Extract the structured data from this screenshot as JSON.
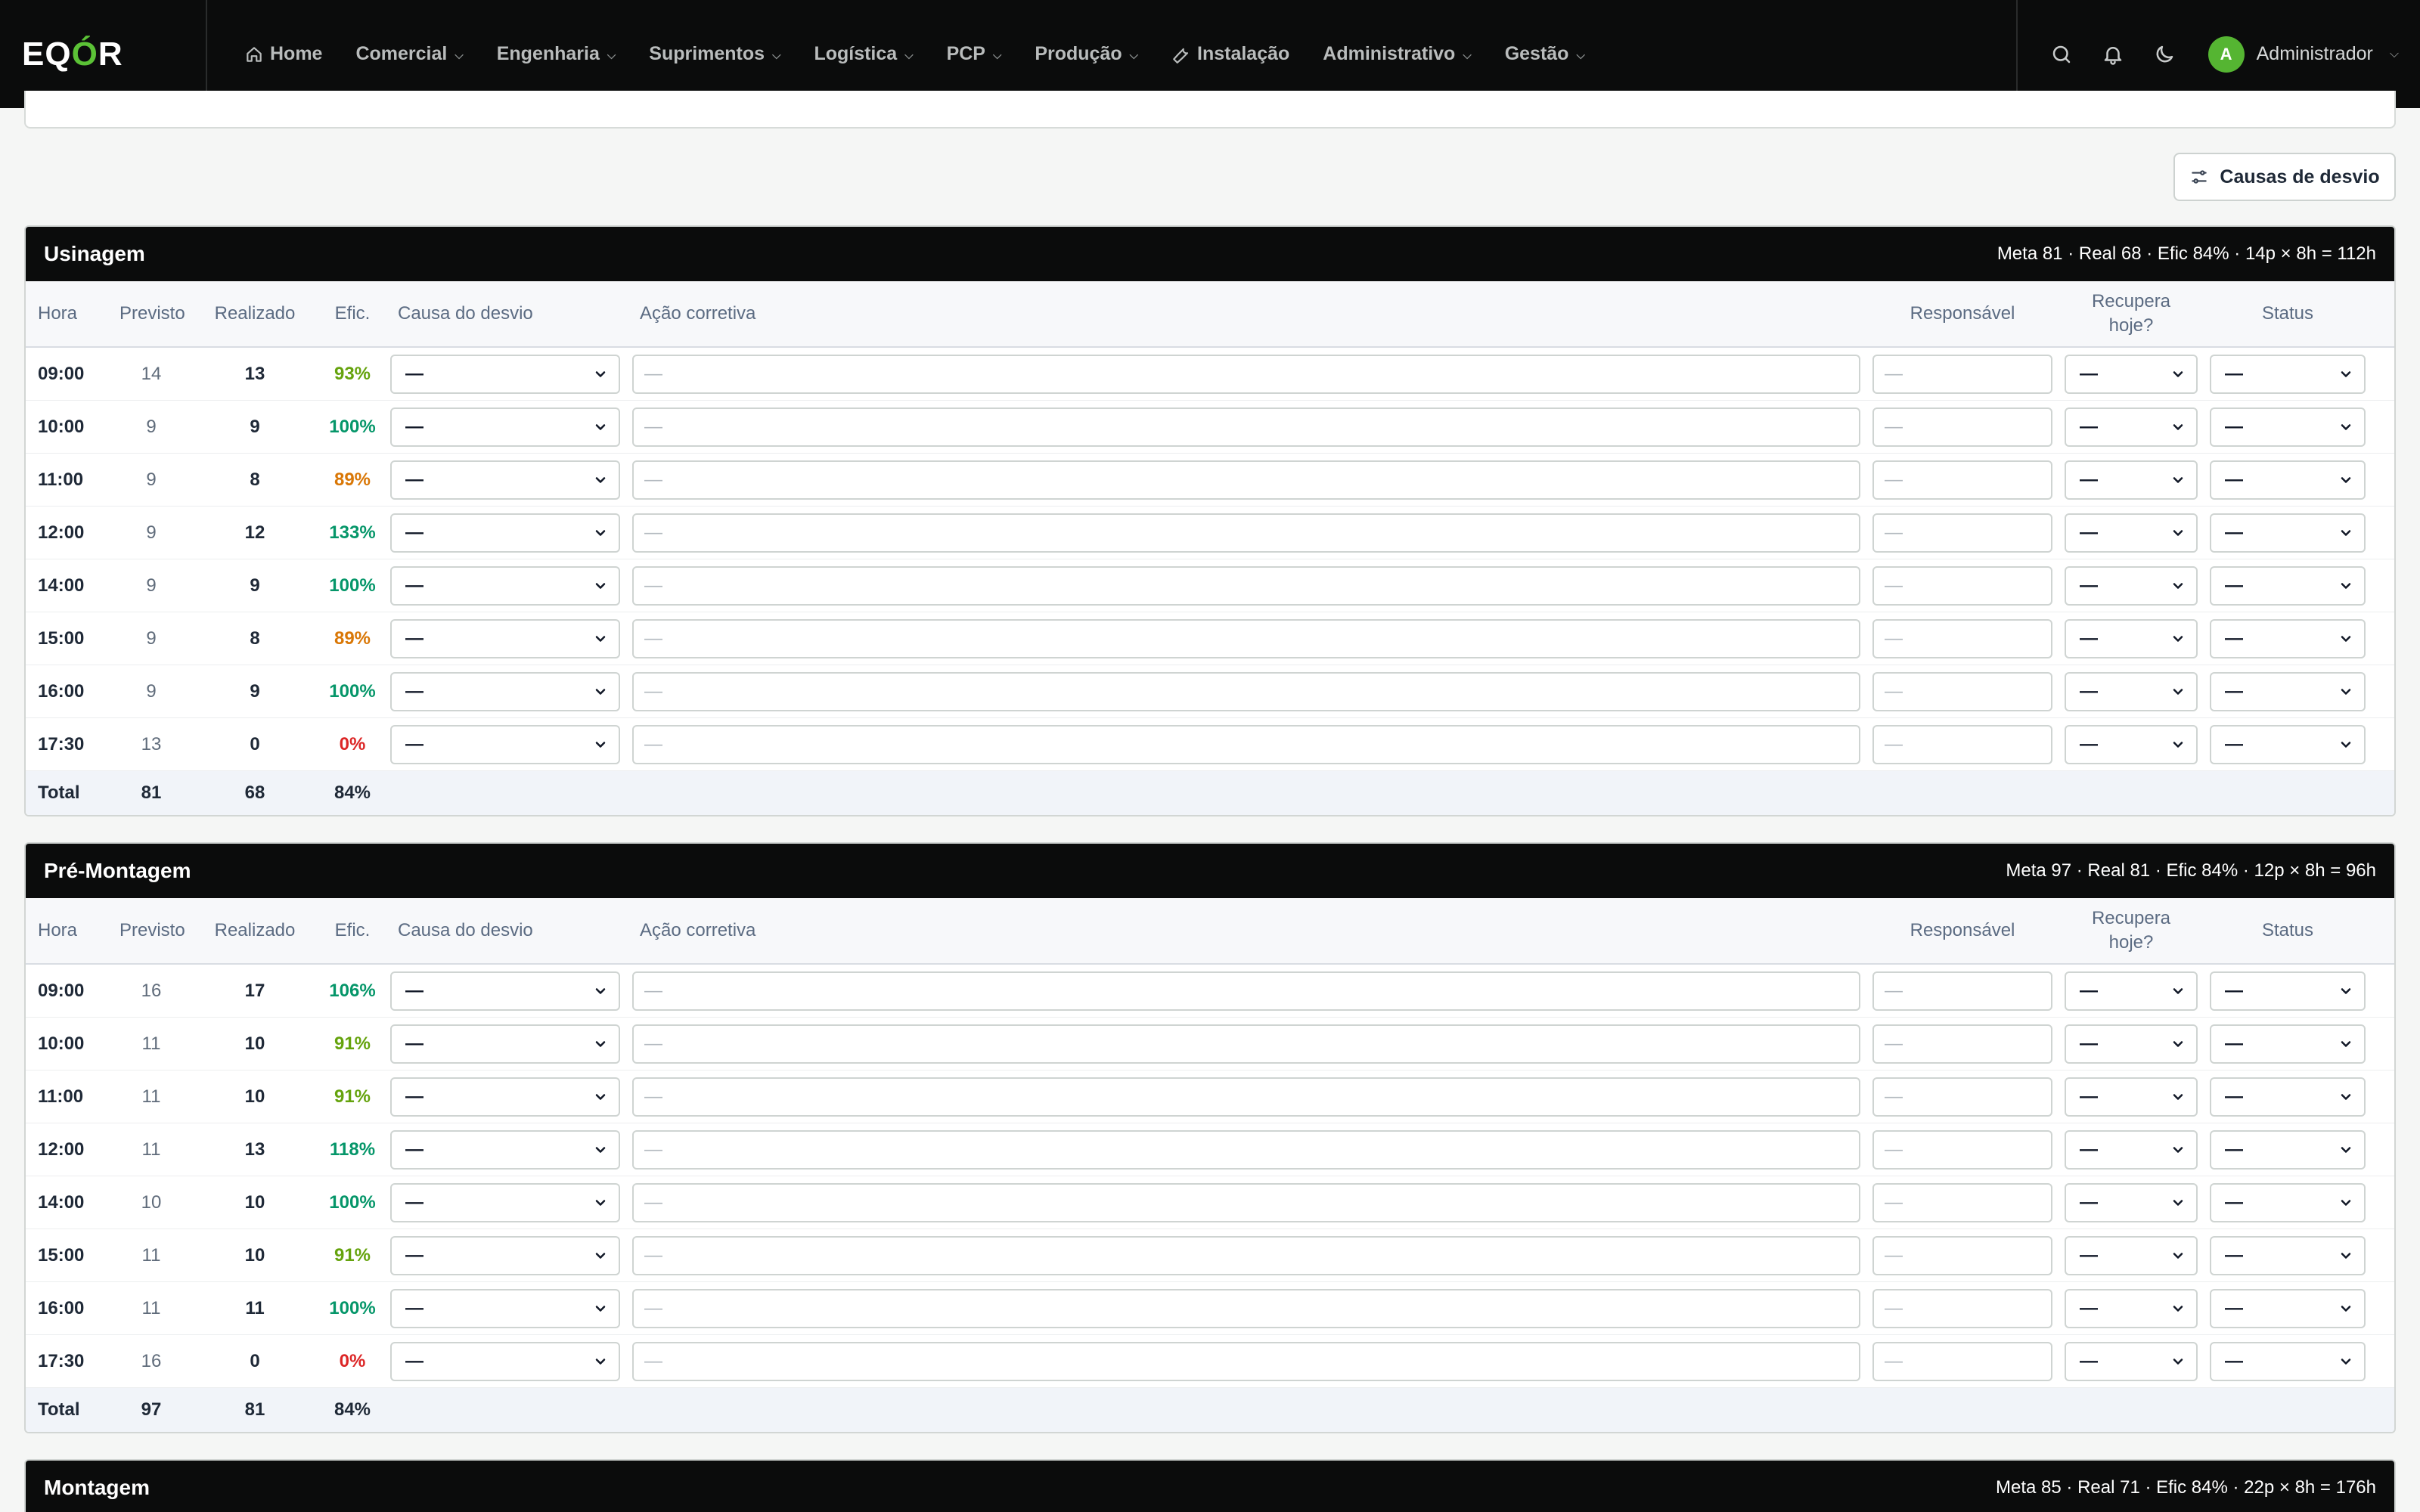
{
  "brand": {
    "prefix": "EQ",
    "o": "Ó",
    "suffix": "R"
  },
  "nav": [
    {
      "label": "Home",
      "icon": "home-icon",
      "dropdown": false
    },
    {
      "label": "Comercial",
      "dropdown": true
    },
    {
      "label": "Engenharia",
      "dropdown": true
    },
    {
      "label": "Suprimentos",
      "dropdown": true
    },
    {
      "label": "Logística",
      "dropdown": true
    },
    {
      "label": "PCP",
      "dropdown": true
    },
    {
      "label": "Produção",
      "dropdown": true
    },
    {
      "label": "Instalação",
      "icon": "wrench-icon",
      "dropdown": false
    },
    {
      "label": "Administrativo",
      "dropdown": true
    },
    {
      "label": "Gestão",
      "dropdown": true
    }
  ],
  "user": {
    "initial": "A",
    "name": "Administrador"
  },
  "causas_button": "Causas de desvio",
  "columns": {
    "hora": "Hora",
    "previsto": "Previsto",
    "realizado": "Realizado",
    "efic": "Efic.",
    "causa": "Causa do desvio",
    "acao": "Ação corretiva",
    "responsavel": "Responsável",
    "recupera": "Recupera hoje?",
    "status": "Status"
  },
  "placeholder": "—",
  "select_value": "—",
  "total_label": "Total",
  "sections": [
    {
      "title": "Usinagem",
      "summary": "Meta 81 · Real 68 · Efic 84% · 14p × 8h = 112h",
      "rows": [
        {
          "hora": "09:00",
          "previsto": "14",
          "realizado": "13",
          "efic": "93%",
          "tone": "lime"
        },
        {
          "hora": "10:00",
          "previsto": "9",
          "realizado": "9",
          "efic": "100%",
          "tone": "teal"
        },
        {
          "hora": "11:00",
          "previsto": "9",
          "realizado": "8",
          "efic": "89%",
          "tone": "orange"
        },
        {
          "hora": "12:00",
          "previsto": "9",
          "realizado": "12",
          "efic": "133%",
          "tone": "teal"
        },
        {
          "hora": "14:00",
          "previsto": "9",
          "realizado": "9",
          "efic": "100%",
          "tone": "teal"
        },
        {
          "hora": "15:00",
          "previsto": "9",
          "realizado": "8",
          "efic": "89%",
          "tone": "orange"
        },
        {
          "hora": "16:00",
          "previsto": "9",
          "realizado": "9",
          "efic": "100%",
          "tone": "teal"
        },
        {
          "hora": "17:30",
          "previsto": "13",
          "realizado": "0",
          "efic": "0%",
          "tone": "red"
        }
      ],
      "total": {
        "previsto": "81",
        "realizado": "68",
        "efic": "84%",
        "tone": "orange"
      }
    },
    {
      "title": "Pré-Montagem",
      "summary": "Meta 97 · Real 81 · Efic 84% · 12p × 8h = 96h",
      "rows": [
        {
          "hora": "09:00",
          "previsto": "16",
          "realizado": "17",
          "efic": "106%",
          "tone": "teal"
        },
        {
          "hora": "10:00",
          "previsto": "11",
          "realizado": "10",
          "efic": "91%",
          "tone": "lime"
        },
        {
          "hora": "11:00",
          "previsto": "11",
          "realizado": "10",
          "efic": "91%",
          "tone": "lime"
        },
        {
          "hora": "12:00",
          "previsto": "11",
          "realizado": "13",
          "efic": "118%",
          "tone": "teal"
        },
        {
          "hora": "14:00",
          "previsto": "10",
          "realizado": "10",
          "efic": "100%",
          "tone": "teal"
        },
        {
          "hora": "15:00",
          "previsto": "11",
          "realizado": "10",
          "efic": "91%",
          "tone": "lime"
        },
        {
          "hora": "16:00",
          "previsto": "11",
          "realizado": "11",
          "efic": "100%",
          "tone": "teal"
        },
        {
          "hora": "17:30",
          "previsto": "16",
          "realizado": "0",
          "efic": "0%",
          "tone": "red"
        }
      ],
      "total": {
        "previsto": "97",
        "realizado": "81",
        "efic": "84%",
        "tone": "orange"
      }
    },
    {
      "title": "Montagem",
      "summary": "Meta 85 · Real 71 · Efic 84% · 22p × 8h = 176h",
      "rows": [],
      "total": null
    }
  ]
}
